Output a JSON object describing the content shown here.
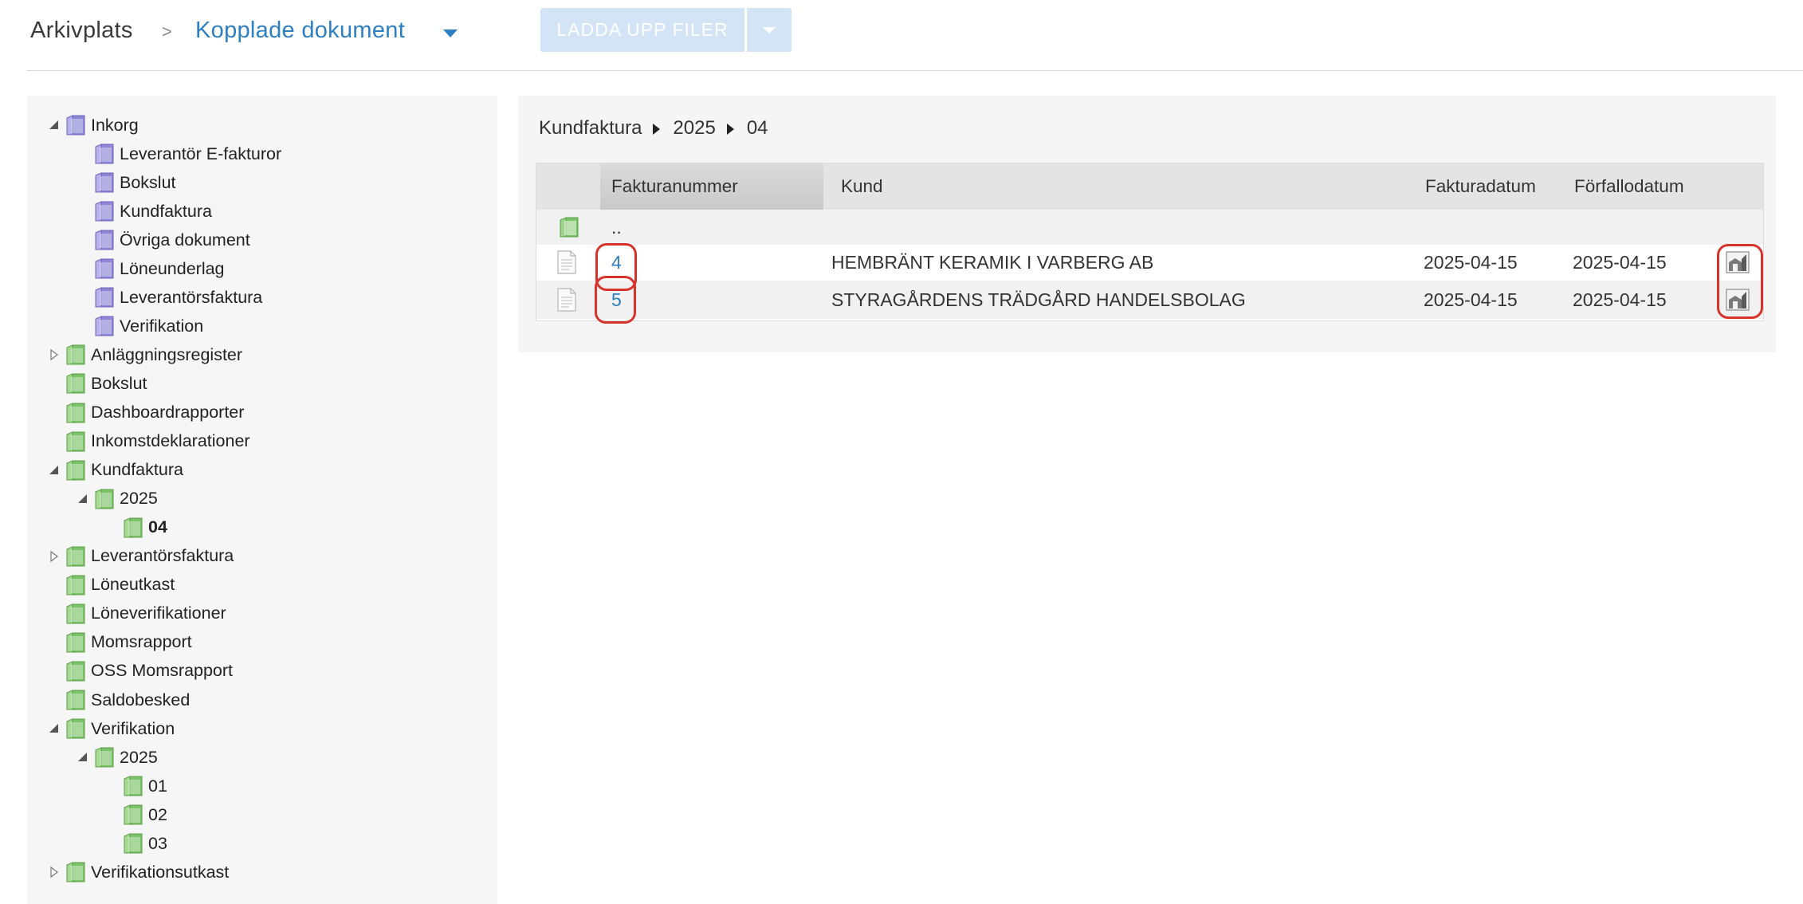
{
  "header": {
    "root_label": "Arkivplats",
    "separator": ">",
    "current_label": "Kopplade dokument",
    "upload_label": "LADDA UPP FILER"
  },
  "tree": [
    {
      "label": "Inkorg",
      "toggle": "open",
      "color": "purple",
      "depth": 0
    },
    {
      "label": "Leverantör E-fakturor",
      "toggle": "none",
      "color": "purple",
      "depth": 1
    },
    {
      "label": "Bokslut",
      "toggle": "none",
      "color": "purple",
      "depth": 1
    },
    {
      "label": "Kundfaktura",
      "toggle": "none",
      "color": "purple",
      "depth": 1
    },
    {
      "label": "Övriga dokument",
      "toggle": "none",
      "color": "purple",
      "depth": 1
    },
    {
      "label": "Löneunderlag",
      "toggle": "none",
      "color": "purple",
      "depth": 1
    },
    {
      "label": "Leverantörsfaktura",
      "toggle": "none",
      "color": "purple",
      "depth": 1
    },
    {
      "label": "Verifikation",
      "toggle": "none",
      "color": "purple",
      "depth": 1
    },
    {
      "label": "Anläggningsregister",
      "toggle": "closed",
      "color": "green",
      "depth": 0
    },
    {
      "label": "Bokslut",
      "toggle": "none",
      "color": "green",
      "depth": 0
    },
    {
      "label": "Dashboardrapporter",
      "toggle": "none",
      "color": "green",
      "depth": 0
    },
    {
      "label": "Inkomstdeklarationer",
      "toggle": "none",
      "color": "green",
      "depth": 0
    },
    {
      "label": "Kundfaktura",
      "toggle": "open",
      "color": "green",
      "depth": 0
    },
    {
      "label": "2025",
      "toggle": "open",
      "color": "green",
      "depth": 1
    },
    {
      "label": "04",
      "toggle": "none",
      "color": "green",
      "depth": 2,
      "selected": true
    },
    {
      "label": "Leverantörsfaktura",
      "toggle": "closed",
      "color": "green",
      "depth": 0
    },
    {
      "label": "Löneutkast",
      "toggle": "none",
      "color": "green",
      "depth": 0
    },
    {
      "label": "Löneverifikationer",
      "toggle": "none",
      "color": "green",
      "depth": 0
    },
    {
      "label": "Momsrapport",
      "toggle": "none",
      "color": "green",
      "depth": 0
    },
    {
      "label": "OSS Momsrapport",
      "toggle": "none",
      "color": "green",
      "depth": 0
    },
    {
      "label": "Saldobesked",
      "toggle": "none",
      "color": "green",
      "depth": 0
    },
    {
      "label": "Verifikation",
      "toggle": "open",
      "color": "green",
      "depth": 0
    },
    {
      "label": "2025",
      "toggle": "open",
      "color": "green",
      "depth": 1
    },
    {
      "label": "01",
      "toggle": "none",
      "color": "green",
      "depth": 2
    },
    {
      "label": "02",
      "toggle": "none",
      "color": "green",
      "depth": 2
    },
    {
      "label": "03",
      "toggle": "none",
      "color": "green",
      "depth": 2
    },
    {
      "label": "Verifikationsutkast",
      "toggle": "closed",
      "color": "green",
      "depth": 0
    }
  ],
  "path": [
    "Kundfaktura",
    "2025",
    "04"
  ],
  "grid": {
    "columns": {
      "number": "Fakturanummer",
      "customer": "Kund",
      "invoice_date": "Fakturadatum",
      "due_date": "Förfallodatum"
    },
    "parent_row_label": "..",
    "rows": [
      {
        "number": "4",
        "customer": "HEMBRÄNT KERAMIK I VARBERG AB",
        "invoice_date": "2025-04-15",
        "due_date": "2025-04-15"
      },
      {
        "number": "5",
        "customer": "STYRAGÅRDENS TRÄDGÅRD HANDELSBOLAG",
        "invoice_date": "2025-04-15",
        "due_date": "2025-04-15"
      }
    ]
  },
  "colors": {
    "link": "#2d7fc1",
    "upload_button": "#d2e4f5",
    "highlight": "#d6332b",
    "folder_purple": "#8e86d6",
    "folder_green": "#7cc26a"
  }
}
